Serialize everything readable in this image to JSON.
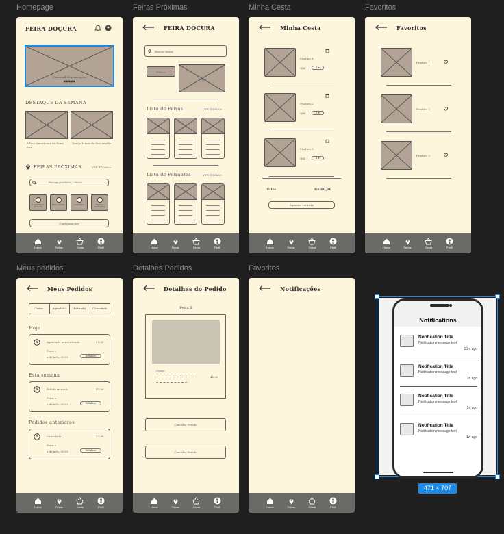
{
  "frames": {
    "homepage": {
      "label": "Homepage",
      "title": "FEIRA DOÇURA",
      "carousel": "Carrossel de promoções",
      "highlight_title": "DESTAQUE DA SEMANA",
      "highlights": [
        "Alface Americana da Dona Ana",
        "Queijo Minas do Seu Amélio"
      ],
      "nearby_title": "FEIRAS PRÓXIMAS",
      "see_all": "VER TODAS>",
      "search_placeholder": "Buscar produtos / feiras",
      "categories": [
        "Legumes e verduras",
        "Mel e frutas",
        "Laticínios",
        "Bens e derivados"
      ],
      "config_button": "Configurações"
    },
    "feiras": {
      "label": "Feiras Próximas",
      "title": "FEIRA DOÇURA",
      "search_placeholder": "Buscar feiras",
      "filter": "Filtros",
      "map": "Mapa",
      "list_fairs": "Lista de Feiras",
      "list_vendors": "Lista de Feirantes",
      "see_all": "VER TODAS>"
    },
    "cesta": {
      "label": "Minha Cesta",
      "title": "Minha Cesta",
      "products": [
        "Produto 1",
        "Produto 2",
        "Produto 3"
      ],
      "qty_label": "Qtd:",
      "qty_value": "1",
      "total_label": "Total",
      "total_value": "R$ 00,00",
      "schedule_button": "Agendar retirada"
    },
    "favoritos": {
      "label": "Favoritos",
      "title": "Favoritos",
      "products": [
        "Produto 1",
        "Produto 2",
        "Produto 3"
      ]
    },
    "pedidos": {
      "label": "Meus pedidos",
      "title": "Meus Pedidos",
      "filters": [
        "Todos",
        "Agendado",
        "Retirado",
        "Cancelado"
      ],
      "groups": [
        {
          "title": "Hoje",
          "status": "Agendado para retirada",
          "price": "45,00",
          "fair": "Feira x",
          "date": "x de mês, 00:00"
        },
        {
          "title": "Esta semana",
          "status": "Pedido retirado",
          "price": "45,00",
          "fair": "Feira x",
          "date": "x de mês, 00:00"
        },
        {
          "title": "Pedidos anteriores",
          "status": "Cancelado",
          "price": "27,00",
          "fair": "Feira x",
          "date": "x de mês, 00:00"
        }
      ],
      "details_button": "Detalhes"
    },
    "detalhes": {
      "label": "Detalhes Pedidos",
      "title": "Detalhes do Pedido",
      "fair": "Feira X",
      "item": "Couve",
      "item_price": "45,00",
      "cancel_button": "Cancelar Pedido",
      "cancel_button_2": "Cancelar Pedido"
    },
    "notificacoes": {
      "label": "Favoritos",
      "title": "Notificações"
    }
  },
  "nav": [
    "Home",
    "Feiras",
    "Cesta",
    "Perfil"
  ],
  "phone": {
    "title": "Notifications",
    "items": [
      {
        "title": "Notification Title",
        "msg": "Notification message text",
        "time": "10m ago"
      },
      {
        "title": "Notification Title",
        "msg": "Notification message text",
        "time": "1h ago"
      },
      {
        "title": "Notification Title",
        "msg": "Notification message text",
        "time": "2d ago"
      },
      {
        "title": "Notification Title",
        "msg": "Notification message text",
        "time": "1w ago"
      }
    ],
    "size_badge": "471 × 707"
  },
  "colors": {
    "frame_bg": "#fdf6dd",
    "placeholder": "#b3a394",
    "nav": "#6a6a66",
    "selection": "#1e88e5"
  }
}
